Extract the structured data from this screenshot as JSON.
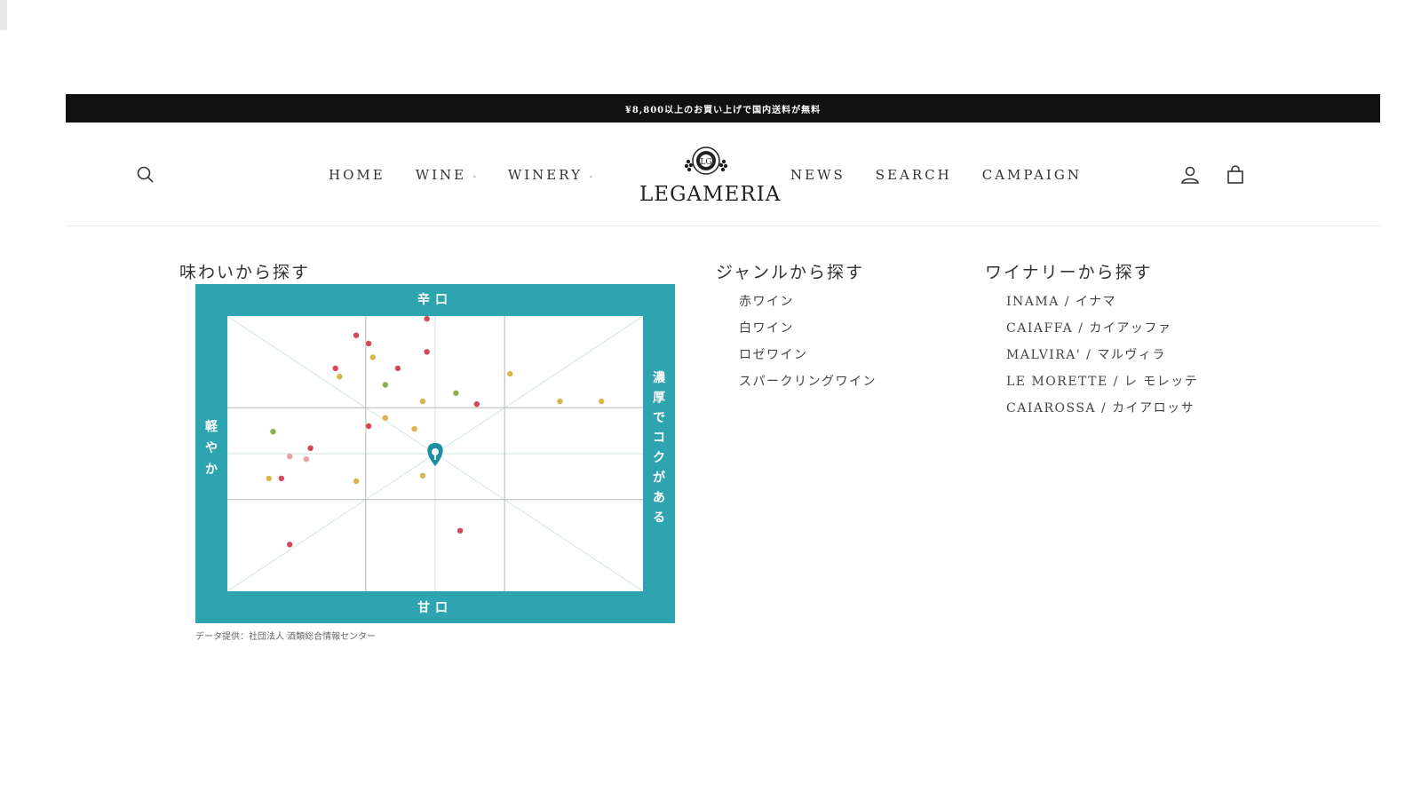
{
  "announcement": "¥8,800以上のお買い上げで国内送料が無料",
  "header": {
    "search_icon": "search-icon",
    "nav_left": [
      {
        "label": "HOME",
        "dropdown": false
      },
      {
        "label": "WINE",
        "dropdown": true
      },
      {
        "label": "WINERY",
        "dropdown": true
      }
    ],
    "logo_text": "LEGAMERIA",
    "nav_right": [
      {
        "label": "NEWS"
      },
      {
        "label": "SEARCH"
      },
      {
        "label": "CAMPAIGN"
      }
    ],
    "account_icon": "user-icon",
    "cart_icon": "bag-icon"
  },
  "taste": {
    "title": "味わいから探す",
    "credit": "データ提供：社団法人 酒類総合情報センター",
    "colors": {
      "frame": "#2fa4b1",
      "red": "#d4485a",
      "yellow": "#d8b54a",
      "green": "#8bb04a",
      "pink": "#e9a0a8",
      "pin": "#1a8fa0"
    }
  },
  "chart_data": {
    "type": "scatter",
    "top_label": "辛口",
    "bottom_label": "甘口",
    "left_label": "軽やか",
    "right_label": "濃厚でコクがある",
    "xlim": [
      0,
      100
    ],
    "ylim": [
      0,
      100
    ],
    "pin": {
      "x": 50,
      "y": 50
    },
    "points": [
      {
        "x": 48,
        "y": 99,
        "color": "red"
      },
      {
        "x": 31,
        "y": 93,
        "color": "red"
      },
      {
        "x": 34,
        "y": 90,
        "color": "red"
      },
      {
        "x": 48,
        "y": 87,
        "color": "red"
      },
      {
        "x": 35,
        "y": 85,
        "color": "yellow"
      },
      {
        "x": 26,
        "y": 81,
        "color": "red"
      },
      {
        "x": 41,
        "y": 81,
        "color": "red"
      },
      {
        "x": 27,
        "y": 78,
        "color": "yellow"
      },
      {
        "x": 38,
        "y": 75,
        "color": "green"
      },
      {
        "x": 68,
        "y": 79,
        "color": "yellow"
      },
      {
        "x": 55,
        "y": 72,
        "color": "green"
      },
      {
        "x": 47,
        "y": 69,
        "color": "yellow"
      },
      {
        "x": 60,
        "y": 68,
        "color": "red"
      },
      {
        "x": 80,
        "y": 69,
        "color": "yellow"
      },
      {
        "x": 90,
        "y": 69,
        "color": "yellow"
      },
      {
        "x": 38,
        "y": 63,
        "color": "yellow"
      },
      {
        "x": 34,
        "y": 60,
        "color": "red"
      },
      {
        "x": 45,
        "y": 59,
        "color": "yellow"
      },
      {
        "x": 11,
        "y": 58,
        "color": "green"
      },
      {
        "x": 20,
        "y": 52,
        "color": "red"
      },
      {
        "x": 15,
        "y": 49,
        "color": "pink"
      },
      {
        "x": 19,
        "y": 48,
        "color": "pink"
      },
      {
        "x": 10,
        "y": 41,
        "color": "yellow"
      },
      {
        "x": 13,
        "y": 41,
        "color": "red"
      },
      {
        "x": 31,
        "y": 40,
        "color": "yellow"
      },
      {
        "x": 47,
        "y": 42,
        "color": "yellow"
      },
      {
        "x": 56,
        "y": 22,
        "color": "red"
      },
      {
        "x": 15,
        "y": 17,
        "color": "red"
      }
    ]
  },
  "genre": {
    "title": "ジャンルから探す",
    "items": [
      "赤ワイン",
      "白ワイン",
      "ロゼワイン",
      "スパークリングワイン"
    ]
  },
  "winery": {
    "title": "ワイナリーから探す",
    "items": [
      "INAMA / イナマ",
      "CAIAFFA / カイアッファ",
      "MALVIRA' / マルヴィラ",
      "LE MORETTE / レ モレッテ",
      "CAIAROSSA / カイアロッサ"
    ]
  }
}
